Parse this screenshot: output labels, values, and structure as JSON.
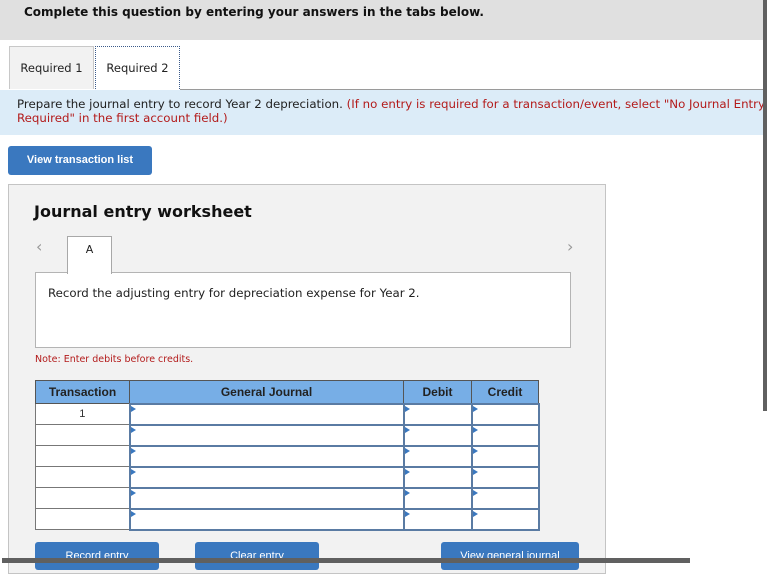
{
  "banner": {
    "text": "Complete this question by entering your answers in the tabs below."
  },
  "tabs": [
    {
      "label": "Required 1",
      "active": false
    },
    {
      "label": "Required 2",
      "active": true
    }
  ],
  "instructions": {
    "main": "Prepare the journal entry to record Year 2 depreciation. ",
    "note_line1": "(If no entry is required for a transaction/event, select \"No Journal Entry",
    "note_line2": "Required\" in the first account field.)"
  },
  "buttons": {
    "view_transaction_list": "View transaction list",
    "record_entry": "Record entry",
    "clear_entry": "Clear entry",
    "view_general_journal": "View general journal"
  },
  "worksheet": {
    "title": "Journal entry worksheet",
    "prev_icon": "‹",
    "next_icon": "›",
    "entry_tab": "A",
    "description": "Record the adjusting entry for depreciation expense for Year 2.",
    "note": "Note: Enter debits before credits.",
    "table": {
      "headers": [
        "Transaction",
        "General Journal",
        "Debit",
        "Credit"
      ],
      "rows": [
        {
          "transaction": "1",
          "account": "",
          "debit": "",
          "credit": ""
        },
        {
          "transaction": "",
          "account": "",
          "debit": "",
          "credit": ""
        },
        {
          "transaction": "",
          "account": "",
          "debit": "",
          "credit": ""
        },
        {
          "transaction": "",
          "account": "",
          "debit": "",
          "credit": ""
        },
        {
          "transaction": "",
          "account": "",
          "debit": "",
          "credit": ""
        },
        {
          "transaction": "",
          "account": "",
          "debit": "",
          "credit": ""
        }
      ]
    }
  },
  "colors": {
    "accent_blue": "#3a78bf",
    "header_blue": "#77aee6",
    "note_red": "#b31b1b",
    "instruction_bg": "#dcecf8"
  }
}
